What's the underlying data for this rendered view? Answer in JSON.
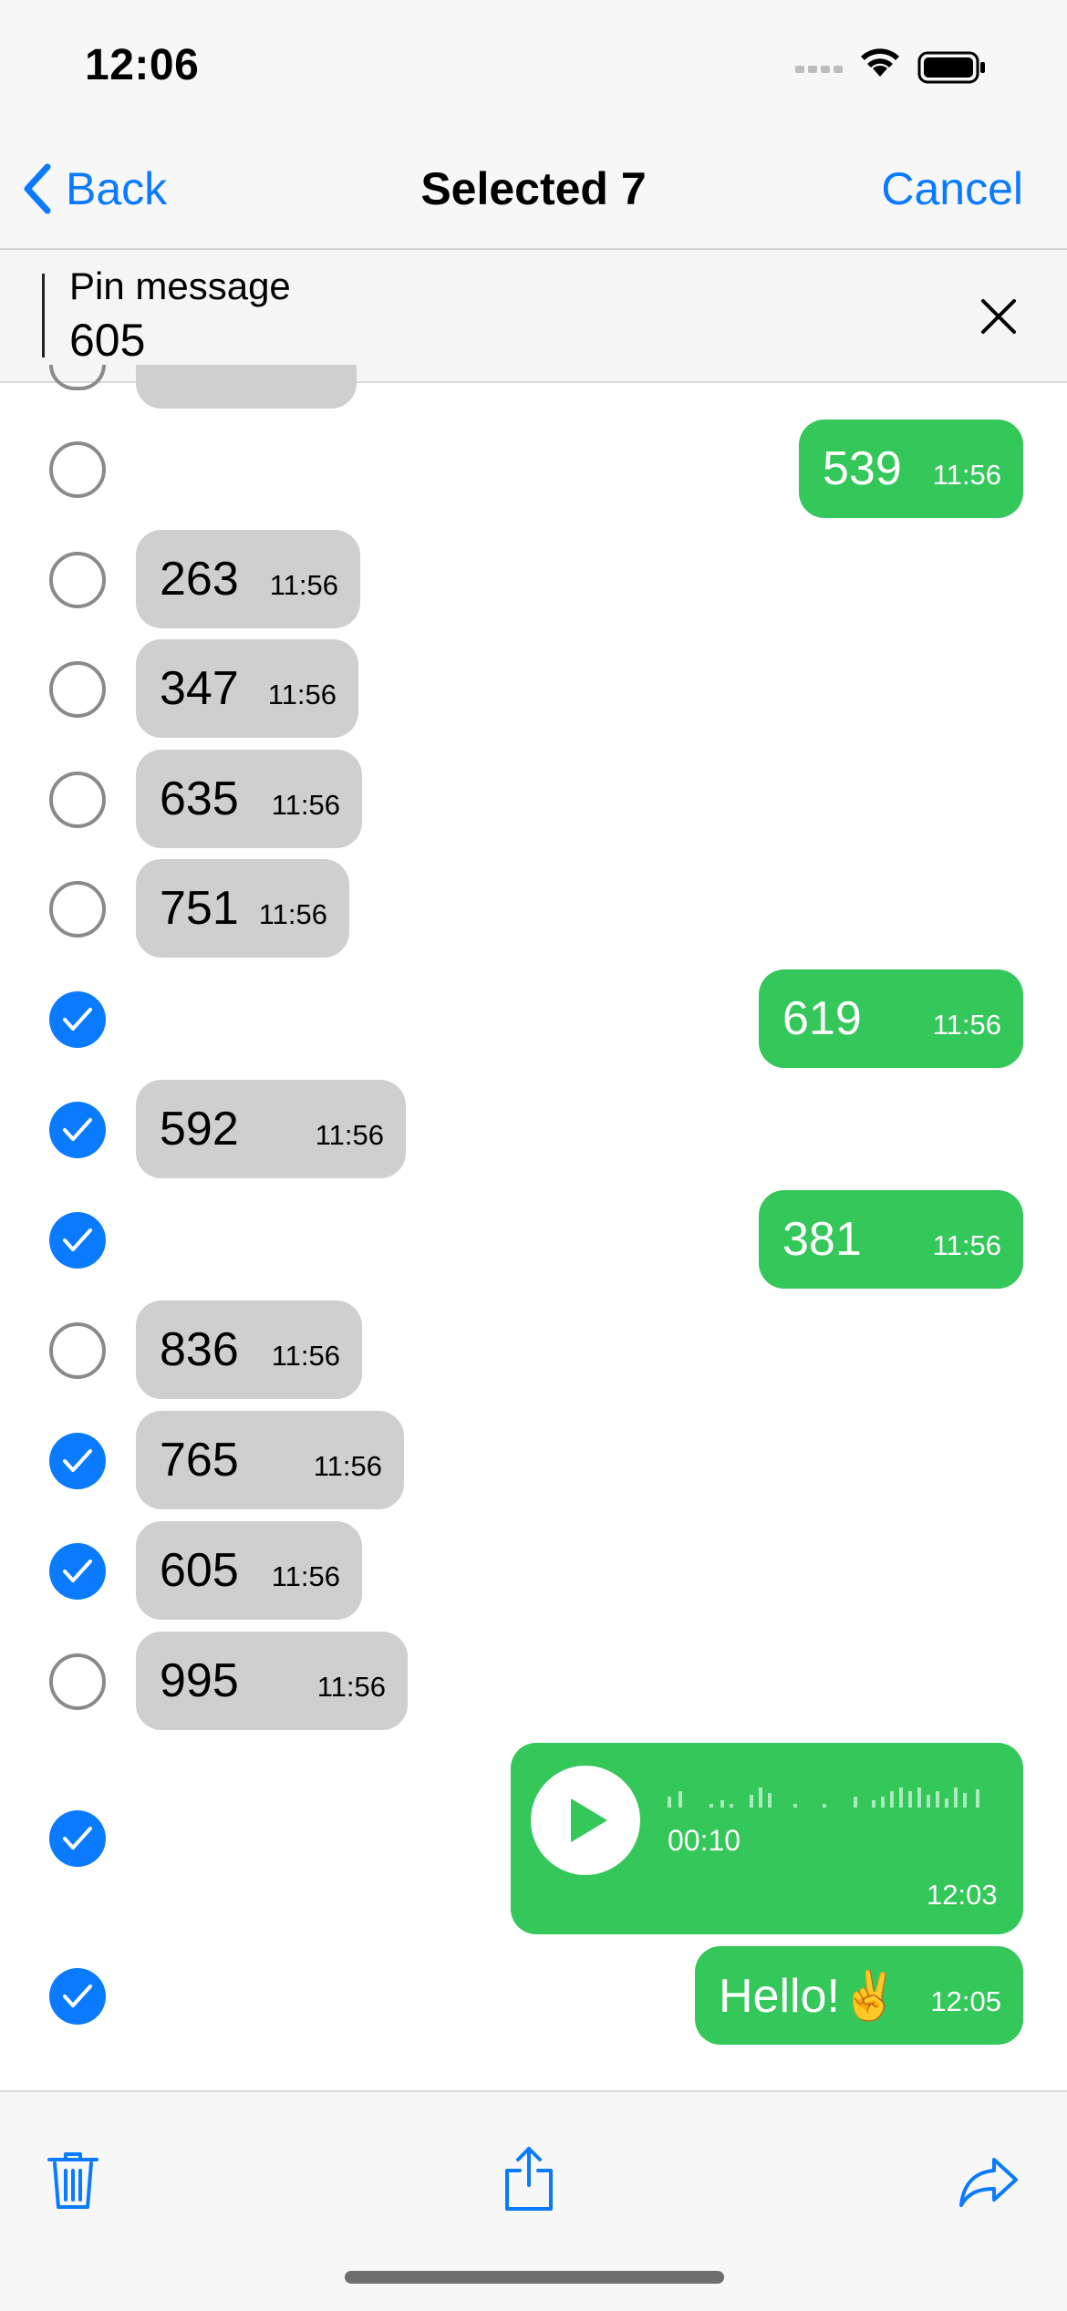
{
  "status_bar": {
    "time": "12:06"
  },
  "nav": {
    "back_label": "Back",
    "title": "Selected 7",
    "cancel_label": "Cancel"
  },
  "pin": {
    "title": "Pin message",
    "value": "605"
  },
  "messages": [
    {
      "text": "539",
      "time": "11:56",
      "direction": "out",
      "selected": false
    },
    {
      "text": "263",
      "time": "11:56",
      "direction": "in",
      "selected": false
    },
    {
      "text": "347",
      "time": "11:56",
      "direction": "in",
      "selected": false
    },
    {
      "text": "635",
      "time": "11:56",
      "direction": "in",
      "selected": false
    },
    {
      "text": "751",
      "time": "11:56",
      "direction": "in",
      "selected": false
    },
    {
      "text": "619",
      "time": "11:56",
      "direction": "out",
      "selected": true
    },
    {
      "text": "592",
      "time": "11:56",
      "direction": "in",
      "selected": true
    },
    {
      "text": "381",
      "time": "11:56",
      "direction": "out",
      "selected": true
    },
    {
      "text": "836",
      "time": "11:56",
      "direction": "in",
      "selected": false
    },
    {
      "text": "765",
      "time": "11:56",
      "direction": "in",
      "selected": true
    },
    {
      "text": "605",
      "time": "11:56",
      "direction": "in",
      "selected": true
    },
    {
      "text": "995",
      "time": "11:56",
      "direction": "in",
      "selected": false
    },
    {
      "text": "Hello!✌️",
      "time": "12:05",
      "direction": "out",
      "selected": true
    }
  ],
  "voice_message": {
    "duration": "00:10",
    "time": "12:03",
    "selected": true
  },
  "colors": {
    "accent": "#0a7bff",
    "outgoing": "#34c759",
    "incoming": "#cfcfcf"
  },
  "toolbar": {
    "icons": [
      "trash-icon",
      "share-icon",
      "forward-icon"
    ]
  }
}
